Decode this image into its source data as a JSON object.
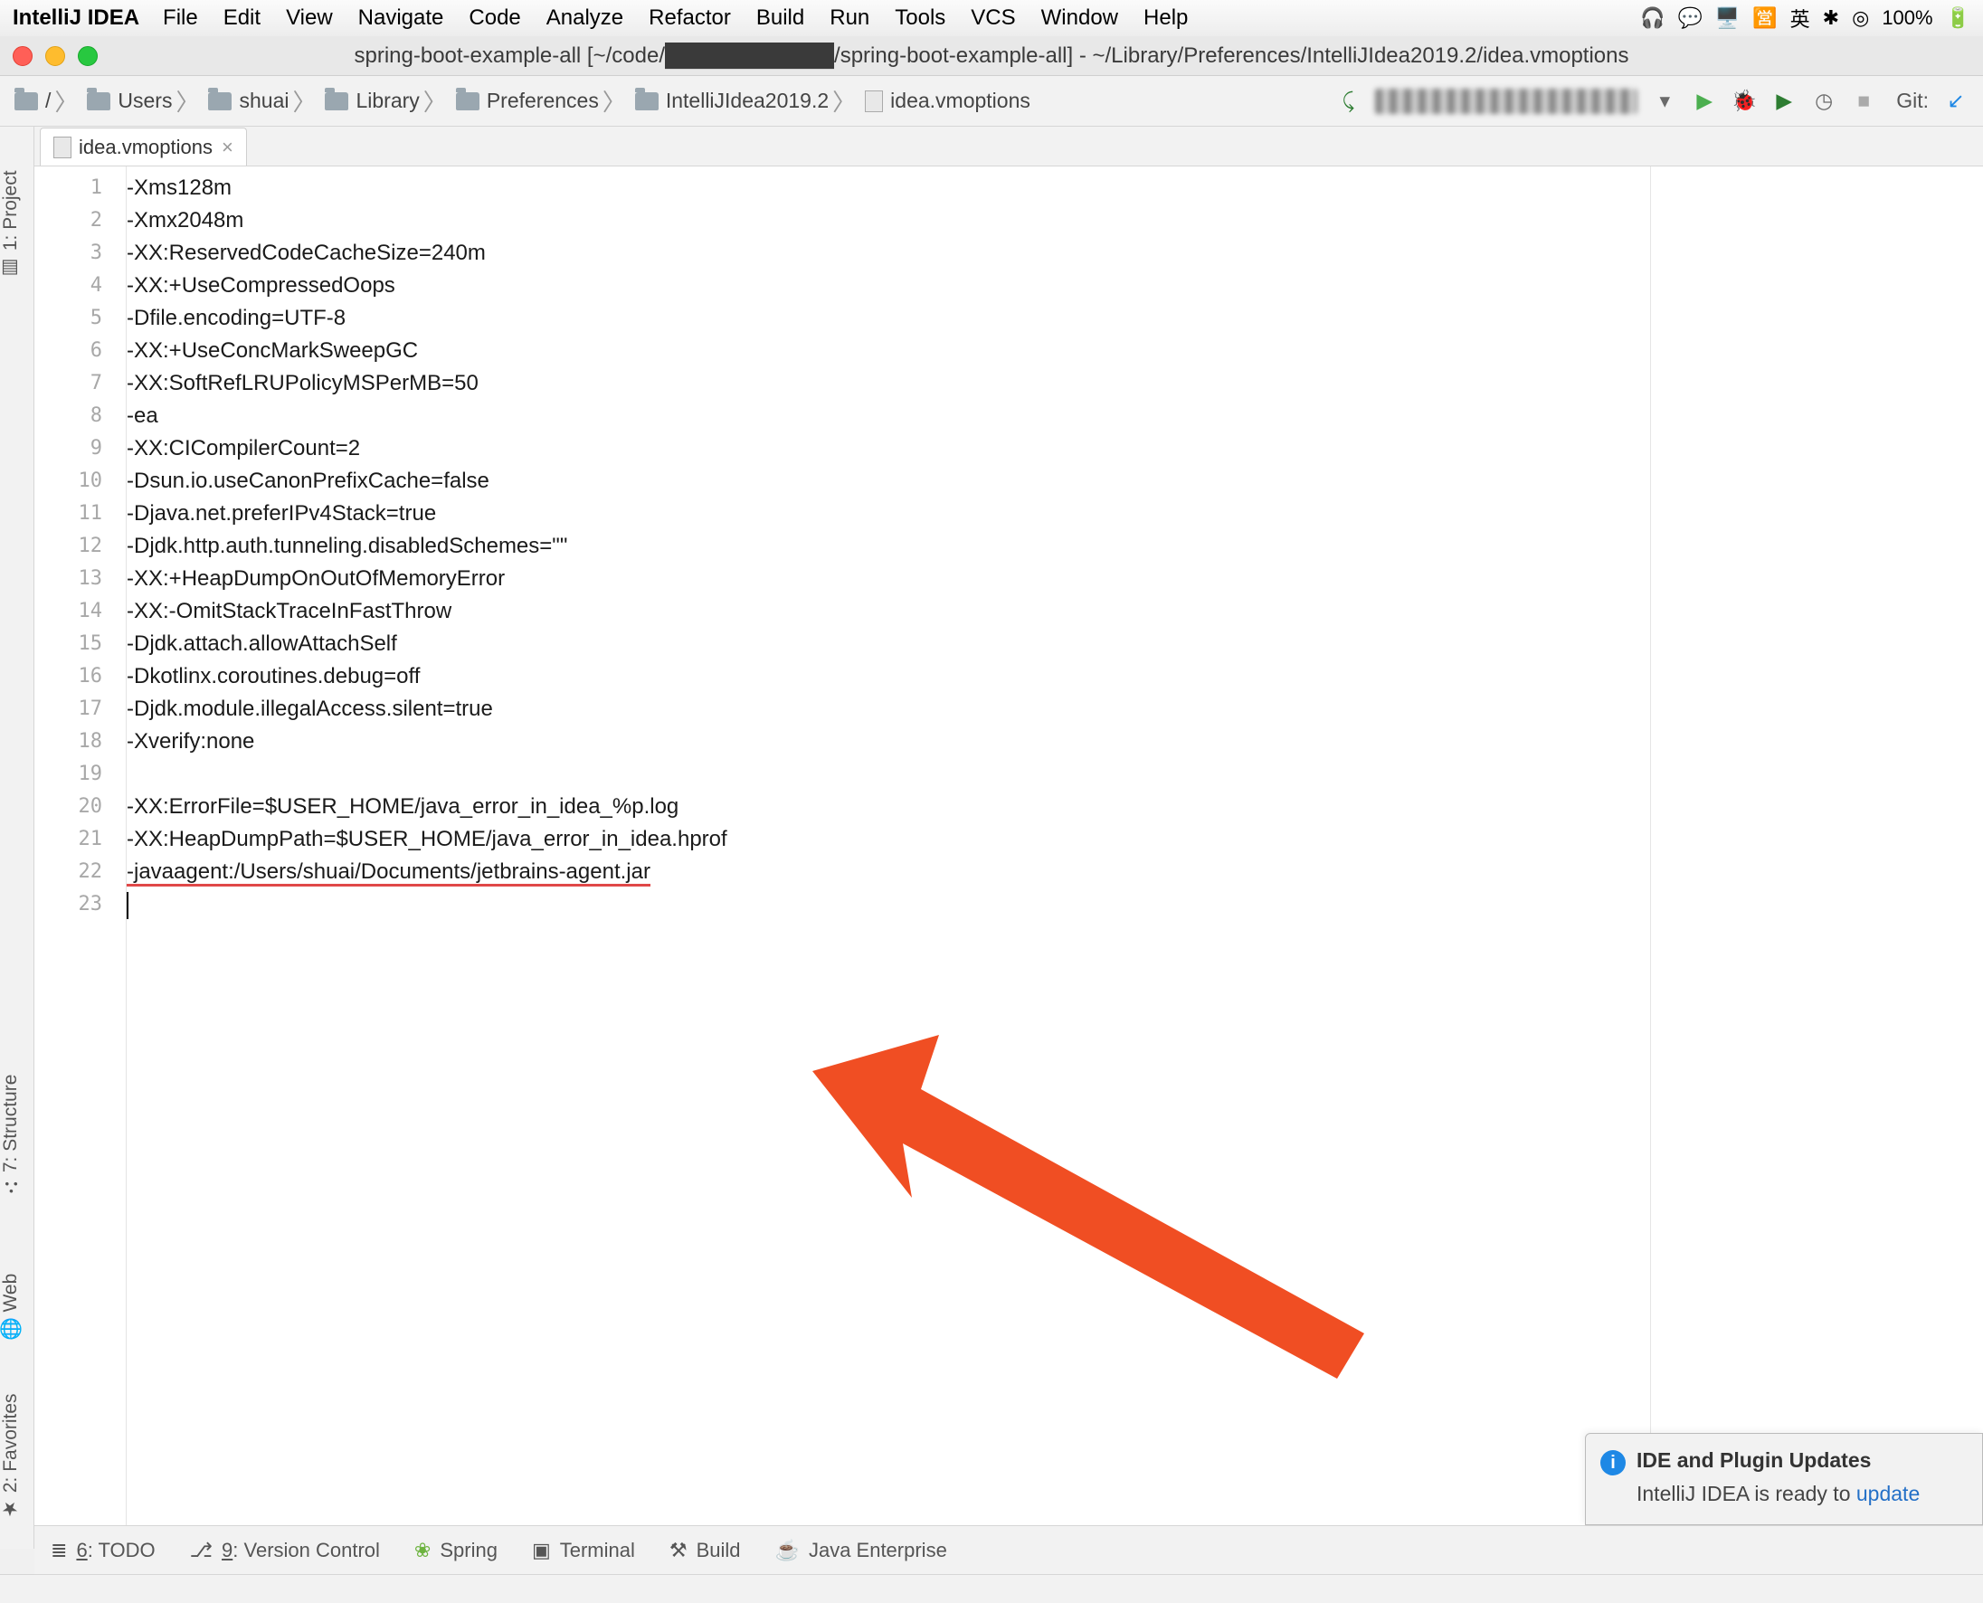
{
  "menubar": {
    "app": "IntelliJ IDEA",
    "items": [
      "File",
      "Edit",
      "View",
      "Navigate",
      "Code",
      "Analyze",
      "Refactor",
      "Build",
      "Run",
      "Tools",
      "VCS",
      "Window",
      "Help"
    ],
    "battery": "100%"
  },
  "titlebar": {
    "title": "spring-boot-example-all [~/code/███████████/spring-boot-example-all] - ~/Library/Preferences/IntelliJIdea2019.2/idea.vmoptions"
  },
  "breadcrumbs": [
    "/",
    "Users",
    "shuai",
    "Library",
    "Preferences",
    "IntelliJIdea2019.2",
    "idea.vmoptions"
  ],
  "toolbar": {
    "git": "Git:"
  },
  "tabs": {
    "active": "idea.vmoptions"
  },
  "rail": {
    "project": "1: Project",
    "structure": "7: Structure",
    "web": "Web",
    "fav": "2: Favorites"
  },
  "editor": {
    "lines": [
      "-Xms128m",
      "-Xmx2048m",
      "-XX:ReservedCodeCacheSize=240m",
      "-XX:+UseCompressedOops",
      "-Dfile.encoding=UTF-8",
      "-XX:+UseConcMarkSweepGC",
      "-XX:SoftRefLRUPolicyMSPerMB=50",
      "-ea",
      "-XX:CICompilerCount=2",
      "-Dsun.io.useCanonPrefixCache=false",
      "-Djava.net.preferIPv4Stack=true",
      "-Djdk.http.auth.tunneling.disabledSchemes=\"\"",
      "-XX:+HeapDumpOnOutOfMemoryError",
      "-XX:-OmitStackTraceInFastThrow",
      "-Djdk.attach.allowAttachSelf",
      "-Dkotlinx.coroutines.debug=off",
      "-Djdk.module.illegalAccess.silent=true",
      "-Xverify:none",
      "",
      "-XX:ErrorFile=$USER_HOME/java_error_in_idea_%p.log",
      "-XX:HeapDumpPath=$USER_HOME/java_error_in_idea.hprof",
      "-javaagent:/Users/shuai/Documents/jetbrains-agent.jar",
      ""
    ],
    "highlight_line_index": 21
  },
  "bottom_tools": {
    "todo": "6: TODO",
    "vcs": "9: Version Control",
    "spring": "Spring",
    "terminal": "Terminal",
    "build": "Build",
    "jee": "Java Enterprise"
  },
  "popup": {
    "title": "IDE and Plugin Updates",
    "body_prefix": "IntelliJ IDEA is ready to ",
    "link": "update"
  }
}
